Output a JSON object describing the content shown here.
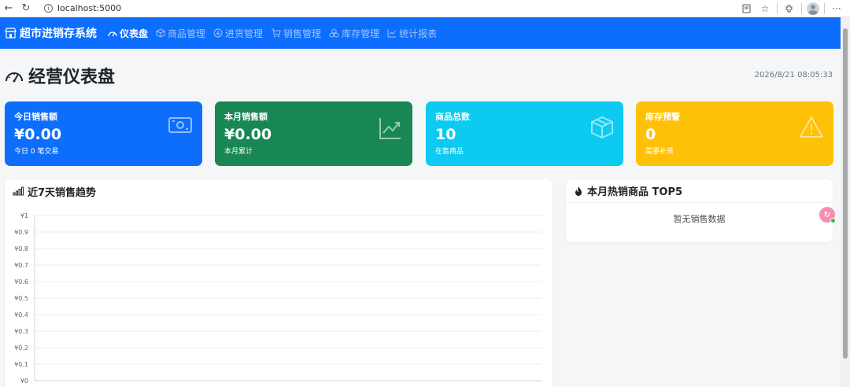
{
  "browser": {
    "url": "localhost:5000"
  },
  "navbar": {
    "brand": "超市进销存系统",
    "items": [
      {
        "label": "仪表盘",
        "icon": "gauge-icon",
        "active": true
      },
      {
        "label": "商品管理",
        "icon": "box-icon",
        "active": false
      },
      {
        "label": "进货管理",
        "icon": "download-circle-icon",
        "active": false
      },
      {
        "label": "销售管理",
        "icon": "cart-icon",
        "active": false
      },
      {
        "label": "库存管理",
        "icon": "boxes-icon",
        "active": false
      },
      {
        "label": "统计报表",
        "icon": "graph-icon",
        "active": false
      }
    ]
  },
  "header": {
    "title": "经营仪表盘",
    "datetime": "2026/8/21 08:05:33"
  },
  "cards": [
    {
      "title": "今日销售额",
      "value": "¥0.00",
      "sub": "今日 0 笔交易",
      "icon": "cash-icon",
      "color": "#0d6efd"
    },
    {
      "title": "本月销售额",
      "value": "¥0.00",
      "sub": "本月累计",
      "icon": "trend-icon",
      "color": "#198754"
    },
    {
      "title": "商品总数",
      "value": "10",
      "sub": "在售商品",
      "icon": "box-icon",
      "color": "#0dcaf0"
    },
    {
      "title": "库存预警",
      "value": "0",
      "sub": "需要补货",
      "icon": "warning-icon",
      "color": "#ffc107"
    }
  ],
  "sales_trend": {
    "title": "近7天销售趋势"
  },
  "top_products": {
    "title": "本月热销商品 TOP5",
    "empty": "暂无销售数据"
  },
  "chart_data": {
    "type": "line",
    "title": "近7天销售趋势",
    "xlabel": "",
    "ylabel": "",
    "yticks": [
      "¥0",
      "¥0.1",
      "¥0.2",
      "¥0.3",
      "¥0.4",
      "¥0.5",
      "¥0.6",
      "¥0.7",
      "¥0.8",
      "¥0.9",
      "¥1"
    ],
    "ylim": [
      0,
      1
    ],
    "grid": true,
    "series": []
  }
}
